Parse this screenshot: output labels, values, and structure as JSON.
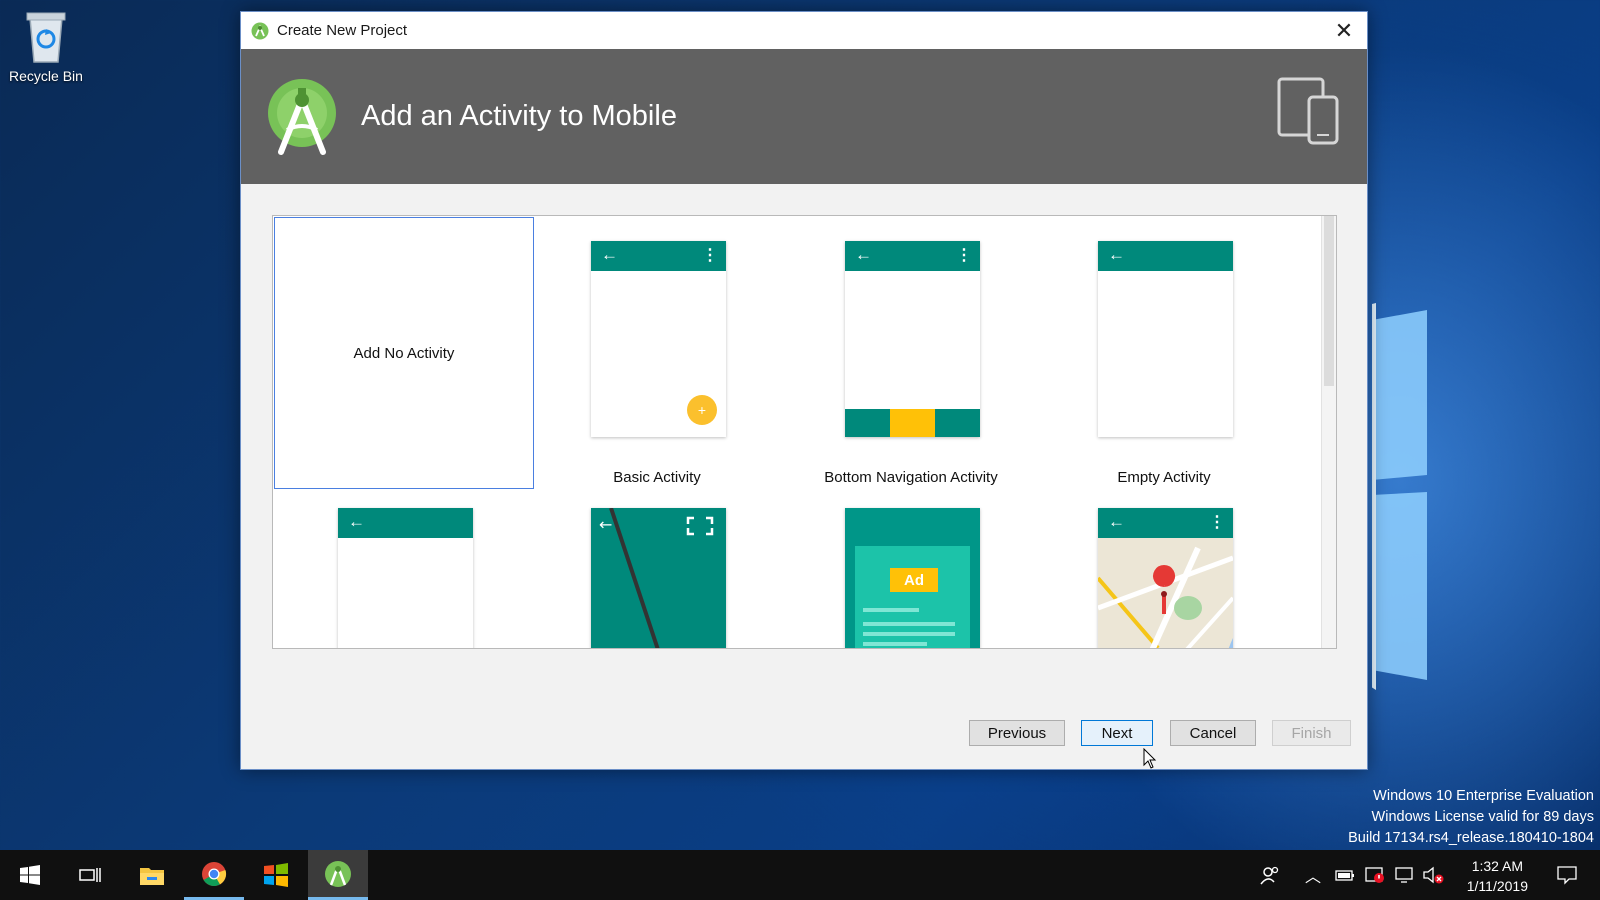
{
  "desktop": {
    "recycle_bin_label": "Recycle Bin",
    "watermark": {
      "line1": "Windows 10 Enterprise Evaluation",
      "line2": "Windows License valid for 89 days",
      "line3": "Build 17134.rs4_release.180410-1804"
    }
  },
  "dialog": {
    "title": "Create New Project",
    "heading": "Add an Activity to Mobile",
    "close_icon": "close-icon",
    "activities": [
      {
        "label": "Add No Activity",
        "selected": true
      },
      {
        "label": "Basic Activity"
      },
      {
        "label": "Bottom Navigation Activity"
      },
      {
        "label": "Empty Activity"
      },
      {
        "label": ""
      },
      {
        "label": ""
      },
      {
        "label": ""
      },
      {
        "label": ""
      }
    ],
    "ad_text": "Ad",
    "fab_text": "+",
    "buttons": {
      "previous": "Previous",
      "next": "Next",
      "cancel": "Cancel",
      "finish": "Finish"
    }
  },
  "taskbar": {
    "apps": [
      "start-icon",
      "task-view-icon",
      "file-explorer-icon",
      "chrome-icon",
      "app-icon",
      "android-studio-icon"
    ],
    "clock": {
      "time": "1:32 AM",
      "date": "1/11/2019"
    }
  },
  "colors": {
    "teal": "#00897b",
    "amber": "#ffc107",
    "banner": "#616161",
    "accent": "#0078d7"
  }
}
